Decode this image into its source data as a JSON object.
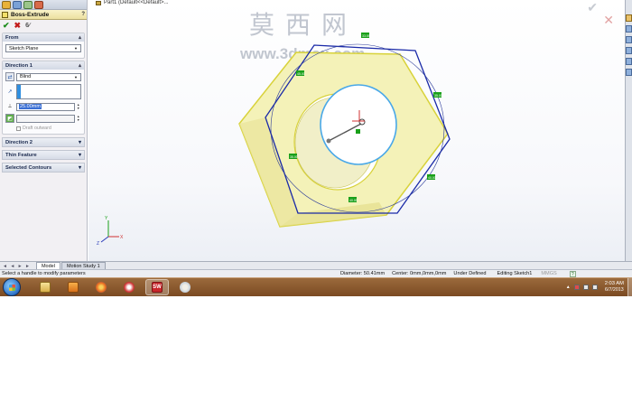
{
  "pm_tabs": [
    "feature-manager-tab",
    "property-manager-tab",
    "configuration-manager-tab",
    "appearance-tab"
  ],
  "property_manager": {
    "title": "Boss-Extrude",
    "help": "?",
    "from": {
      "header": "From",
      "start_condition": "Sketch Plane"
    },
    "direction1": {
      "header": "Direction 1",
      "end_condition": "Blind",
      "depth_value": "25.00mm",
      "draft_label": "Draft outward"
    },
    "collapsed_groups": [
      "Direction 2",
      "Thin Feature",
      "Selected Contours"
    ]
  },
  "graphics": {
    "part_label": "Part1  (Default<<Default>...",
    "watermark_cn": "莫西网",
    "watermark_url": "www.3dmox.com",
    "dimension_handles": [
      "33.59",
      "45.00",
      "35.00",
      "35.00",
      "40.00",
      "40.00"
    ],
    "colors": {
      "nut_face": "#f4f2b8",
      "nut_edge": "#d8d23a",
      "sketch_hex": "#1a2aa8",
      "hole_circle": "#49a8e8",
      "handle": "#1aa01a"
    },
    "triad": {
      "x": "X",
      "y": "Y",
      "z": "Z"
    }
  },
  "view_tabs": {
    "nav": "◄ ◄ ► ►",
    "tabs": [
      "Model",
      "Motion Study 1"
    ],
    "active": "Model"
  },
  "status_bar": {
    "message": "Select a handle to modify parameters",
    "diameter": "Diameter: 50.41mm",
    "center": "Center: 0mm,0mm,0mm",
    "state": "Under Defined",
    "editing": "Editing Sketch1",
    "units": "MMGS",
    "help": "?"
  },
  "taskbar": {
    "apps": [
      "windows-explorer",
      "media-player",
      "firefox",
      "app-4",
      "solidworks",
      "paint"
    ],
    "active_app": "solidworks",
    "solidworks_label": "SW",
    "time": "2:03 AM",
    "date": "6/7/2013"
  }
}
